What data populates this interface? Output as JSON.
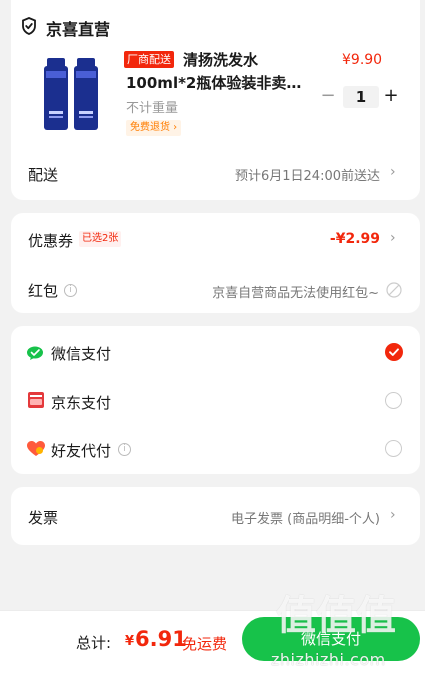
{
  "store": {
    "name": "京喜直营",
    "icon": "shield-check-icon"
  },
  "product": {
    "vendor_tag": "厂商配送",
    "title_line1": "清扬洗发水",
    "title_line2": "100ml*2瓶体验装非卖…",
    "price": "¥9.90",
    "quantity": "1",
    "minus": "−",
    "plus": "+",
    "weight": "不计重量",
    "free_return": "免费退货 ›",
    "image": "shampoo-bottles-image"
  },
  "shipping": {
    "label": "配送",
    "value": "预计6月1日24:00前送达"
  },
  "coupon": {
    "label": "优惠券",
    "badge": "已选2张",
    "value": "-¥2.99"
  },
  "hongbao": {
    "label": "红包",
    "value": "京喜自营商品无法使用红包~"
  },
  "payment": {
    "options": [
      {
        "label": "微信支付",
        "icon": "wechat-pay-icon",
        "selected": true
      },
      {
        "label": "京东支付",
        "icon": "jd-pay-icon",
        "selected": false
      },
      {
        "label": "好友代付",
        "icon": "friend-pay-icon",
        "selected": false
      }
    ]
  },
  "invoice": {
    "label": "发票",
    "value": "电子发票 (商品明细-个人)"
  },
  "footer": {
    "total_label": "总计:",
    "currency": "¥",
    "amount": "6.91",
    "free_shipping": "免运费",
    "pay_button": "微信支付"
  },
  "watermark": {
    "text": "值值值",
    "url": "zhizhizhi.com"
  },
  "colors": {
    "accent": "#f2270c",
    "pay_green": "#17c24a",
    "orange": "#ff7d00"
  }
}
